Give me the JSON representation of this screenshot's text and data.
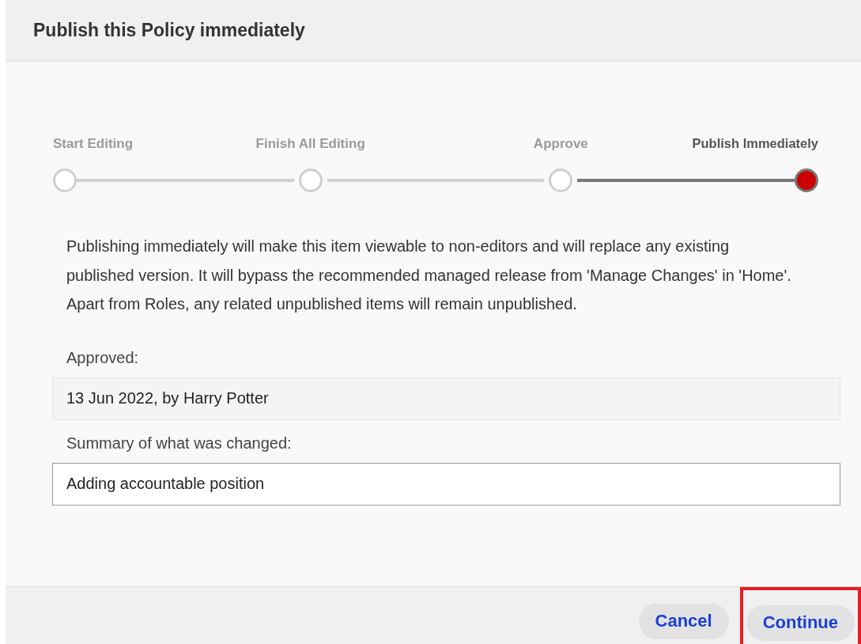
{
  "dialog": {
    "title": "Publish this Policy immediately",
    "steps": [
      {
        "label": "Start Editing",
        "selected": false
      },
      {
        "label": "Finish All Editing",
        "selected": false
      },
      {
        "label": "Approve",
        "selected": false
      },
      {
        "label": "Publish Immediately",
        "selected": true
      }
    ],
    "message": "Publishing immediately will make this item viewable to non-editors and will replace any existing published version. It will bypass the recommended managed release from 'Manage Changes' in 'Home'. Apart from Roles, any related unpublished items will remain unpublished.",
    "fields": [
      {
        "kind": "readonly",
        "label": "Approved:",
        "value": "13 Jun 2022, by Harry Potter"
      },
      {
        "kind": "input",
        "label": "Summary of what was changed:",
        "value": "Adding accountable position"
      }
    ],
    "buttons": [
      {
        "label": "Cancel",
        "highlighted": false
      },
      {
        "label": "Continue",
        "highlighted": true
      }
    ]
  }
}
